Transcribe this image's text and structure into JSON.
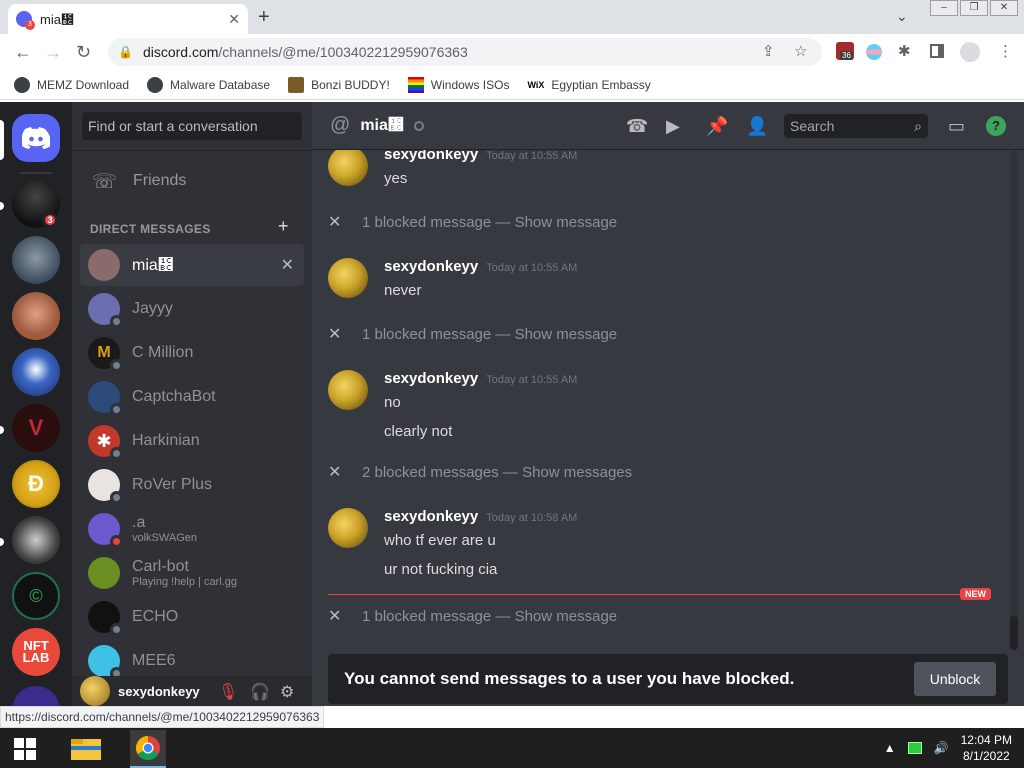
{
  "browser": {
    "tab_title": "mia᲼",
    "tab_badge": "3",
    "url_host": "discord.com",
    "url_path": "/channels/@me/1003402212959076363",
    "ext_badge": "36",
    "status_url": "https://discord.com/channels/@me/1003402212959076363",
    "bookmarks": [
      {
        "label": "MEMZ Download"
      },
      {
        "label": "Malware Database"
      },
      {
        "label": "Bonzi BUDDY!"
      },
      {
        "label": "Windows ISOs"
      },
      {
        "label": "Egyptian Embassy"
      }
    ]
  },
  "guilds": {
    "badge": "3"
  },
  "dm_sidebar": {
    "search_placeholder": "Find or start a conversation",
    "friends_label": "Friends",
    "section_label": "DIRECT MESSAGES",
    "items": [
      {
        "name": "mia᲼",
        "sub": "",
        "color": "#8a6b6b"
      },
      {
        "name": "Jayyy",
        "sub": "",
        "color": "#6b6fb0"
      },
      {
        "name": "C Million",
        "sub": "",
        "color": "#1a1a1a"
      },
      {
        "name": "CaptchaBot",
        "sub": "",
        "color": "#2c4a7a"
      },
      {
        "name": "Harkinian",
        "sub": "",
        "color": "#c0392b"
      },
      {
        "name": "RoVer Plus",
        "sub": "",
        "color": "#e9e4e0"
      },
      {
        "name": ".a",
        "sub": "volkSWAGen",
        "color": "#6a5acd"
      },
      {
        "name": "Carl-bot",
        "sub": "Playing !help | carl.gg",
        "color": "#6b8e23"
      },
      {
        "name": "ECHO",
        "sub": "",
        "color": "#111111"
      },
      {
        "name": "MEE6",
        "sub": "",
        "color": "#3fc1e6"
      }
    ],
    "user": {
      "name": "sexydonkeyy"
    }
  },
  "channel": {
    "name": "mia᲼",
    "search_placeholder": "Search",
    "help": "?"
  },
  "messages": {
    "author": "sexydonkeyy",
    "groups": [
      {
        "time": "Today at 10:55 AM",
        "lines": [
          "yes"
        ]
      },
      {
        "time": "Today at 10:55 AM",
        "lines": [
          "never"
        ]
      },
      {
        "time": "Today at 10:55 AM",
        "lines": [
          "no",
          "clearly not"
        ]
      },
      {
        "time": "Today at 10:58 AM",
        "lines": [
          "who tf ever are u",
          "ur not fucking cia"
        ]
      }
    ],
    "blocked": [
      "1 blocked message — Show message",
      "1 blocked message — Show message",
      "2 blocked messages — Show messages",
      "1 blocked message — Show message"
    ],
    "new_tag": "NEW"
  },
  "blocked_bar": {
    "text": "You cannot send messages to a user you have blocked.",
    "button": "Unblock"
  },
  "taskbar": {
    "time": "12:04 PM",
    "date": "8/1/2022"
  },
  "colors": {
    "discord_bg": "#36393f",
    "sidebar_bg": "#2f3136",
    "guild_bg": "#202225",
    "blurple": "#5865f2",
    "danger": "#ed4245"
  }
}
